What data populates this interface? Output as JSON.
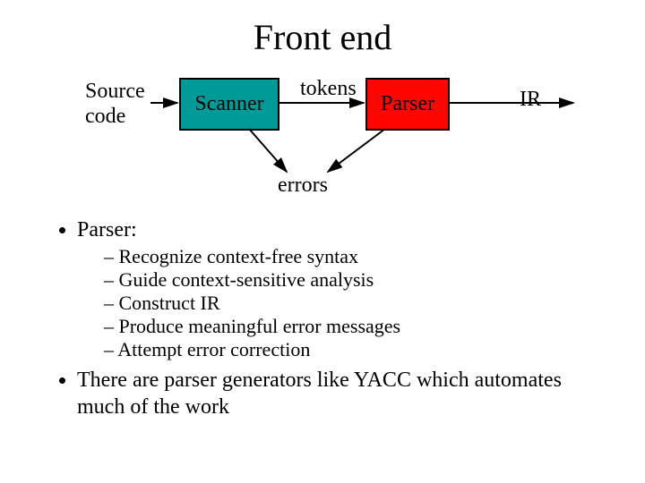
{
  "title": "Front end",
  "diagram": {
    "source_label_line1": "Source",
    "source_label_line2": "code",
    "scanner_label": "Scanner",
    "tokens_label": "tokens",
    "parser_label": "Parser",
    "ir_label": "IR",
    "errors_label": "errors"
  },
  "heading": "Parser:",
  "sub": [
    "Recognize context-free syntax",
    "Guide context-sensitive analysis",
    "Construct IR",
    "Produce meaningful error messages",
    "Attempt error correction"
  ],
  "note": "There are parser generators like YACC which automates much of the work"
}
